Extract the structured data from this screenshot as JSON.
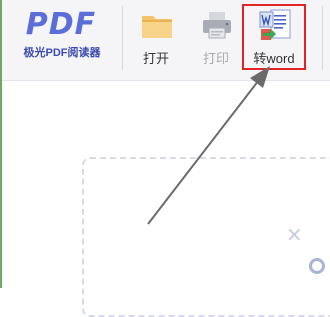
{
  "app": {
    "logo_text": "PDF",
    "subtitle": "极光PDF阅读器"
  },
  "toolbar": {
    "open_label": "打开",
    "print_label": "打印",
    "to_word_label": "转word"
  },
  "icons": {
    "open": "folder-icon",
    "print": "printer-icon",
    "to_word": "word-convert-icon",
    "close": "close-icon",
    "circle": "circle-icon"
  },
  "colors": {
    "brand": "#5b6dd9",
    "highlight": "#e02424",
    "folder": "#f4c36a"
  },
  "states": {
    "print_enabled": false
  }
}
